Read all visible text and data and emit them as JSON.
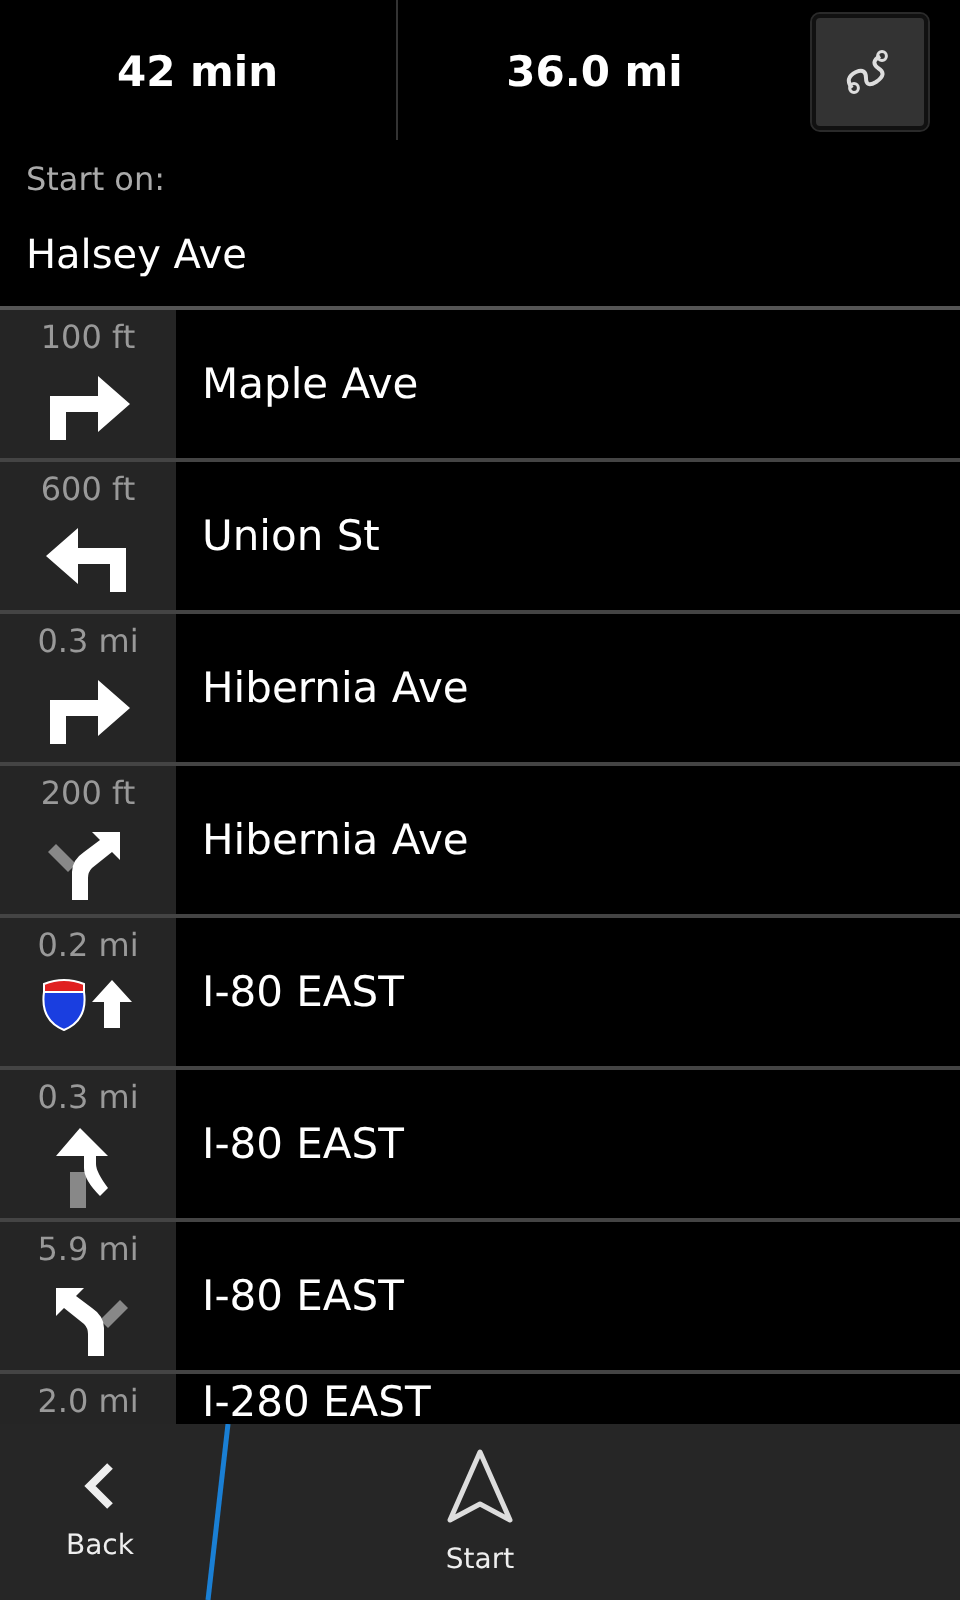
{
  "summary": {
    "time": "42 min",
    "distance": "36.0 mi"
  },
  "start": {
    "label": "Start on:",
    "street": "Halsey Ave"
  },
  "steps": [
    {
      "distance": "100 ft",
      "street": "Maple Ave",
      "kind": "right"
    },
    {
      "distance": "600 ft",
      "street": "Union St",
      "kind": "left"
    },
    {
      "distance": "0.3 mi",
      "street": "Hibernia Ave",
      "kind": "right"
    },
    {
      "distance": "200 ft",
      "street": "Hibernia Ave",
      "kind": "bear-right"
    },
    {
      "distance": "0.2 mi",
      "street": "I-80 EAST",
      "kind": "interstate"
    },
    {
      "distance": "0.3 mi",
      "street": "I-80 EAST",
      "kind": "merge"
    },
    {
      "distance": "5.9 mi",
      "street": "I-80 EAST",
      "kind": "bear-left"
    },
    {
      "distance": "2.0 mi",
      "street": "I-280 EAST"
    }
  ],
  "actions": {
    "back": "Back",
    "start": "Start"
  }
}
